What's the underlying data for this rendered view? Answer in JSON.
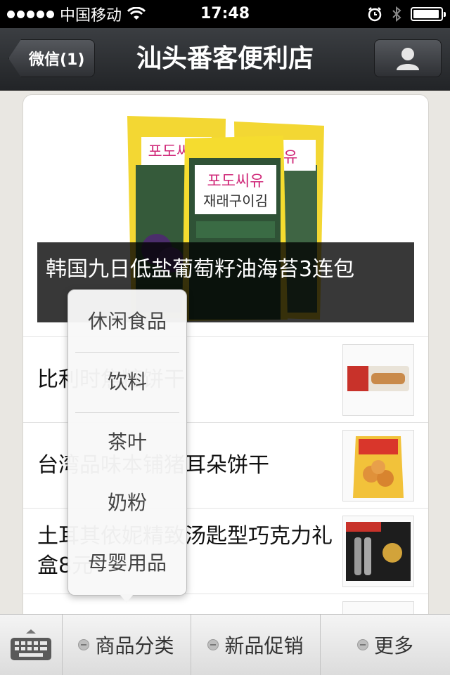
{
  "status_bar": {
    "carrier": "中国移动",
    "time": "17:48",
    "battery_level": 0.95
  },
  "nav": {
    "back_label": "微信(1)",
    "title": "汕头番客便利店"
  },
  "hero": {
    "caption": "韩国九日低盐葡萄籽油海苔3连包"
  },
  "products": [
    {
      "title": "比利时焦糖饼干"
    },
    {
      "title": "台湾品味本铺猪耳朵饼干"
    },
    {
      "title": "土耳其依妮精致汤匙型巧克力礼盒8元"
    }
  ],
  "popup_menu": {
    "items": [
      "休闲食品",
      "饮料",
      "茶叶",
      "奶粉",
      "母婴用品"
    ]
  },
  "bottom_bar": {
    "tabs": [
      "商品分类",
      "新品促销",
      "更多"
    ]
  }
}
